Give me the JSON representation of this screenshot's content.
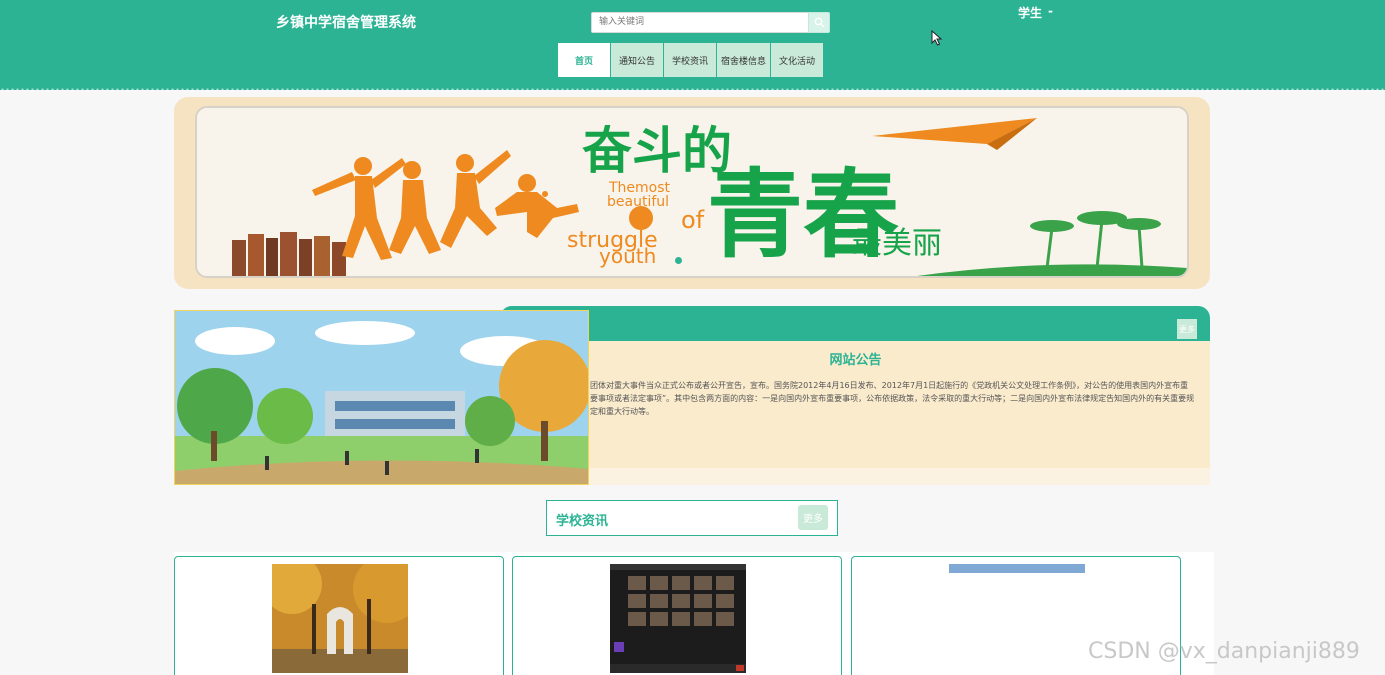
{
  "header": {
    "site_title": "乡镇中学宿舍管理系统",
    "search_placeholder": "输入关键词",
    "user_label": "学生",
    "user_caret": "-"
  },
  "nav": {
    "items": [
      "首页",
      "通知公告",
      "学校资讯",
      "宿舍楼信息",
      "文化活动"
    ]
  },
  "banner": {
    "headline_top": "奋斗的",
    "headline_main": "青春",
    "headline_sub": "最美丽",
    "english_lines": [
      "Themost",
      "beautiful",
      "of",
      "struggle",
      "youth"
    ]
  },
  "announcement": {
    "more": "更多",
    "title": "网站公告",
    "body": "团体对重大事件当众正式公布或者公开宣告，宣布。国务院2012年4月16日发布、2012年7月1日起施行的《党政机关公文处理工作条例》，对公告的使用表国内外宣布重要事项或者法定事项”。其中包含两方面的内容：一是向国内外宣布重要事项，公布依据政策，法令采取的重大行动等；二是向国内外宣布法律规定告知国内外的有关重要规定和重大行动等。"
  },
  "news": {
    "title": "学校资讯",
    "more": "更多"
  },
  "watermark": "CSDN @vx_danpianji889",
  "colors": {
    "primary": "#2bb394",
    "nav_bg": "#c9ead8",
    "banner_bg": "#f6e3c2",
    "announcement_bg": "#faebcd"
  }
}
